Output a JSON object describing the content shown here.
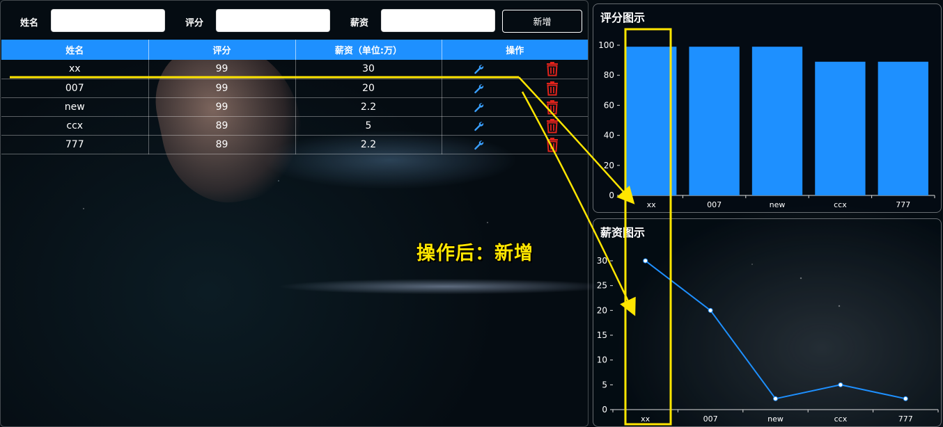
{
  "form": {
    "name_label": "姓名",
    "score_label": "评分",
    "salary_label": "薪资",
    "name_value": "",
    "score_value": "",
    "salary_value": "",
    "add_button": "新增"
  },
  "table": {
    "headers": [
      "姓名",
      "评分",
      "薪资（单位:万）",
      "操作"
    ],
    "rows": [
      {
        "name": "xx",
        "score": "99",
        "salary": "30"
      },
      {
        "name": "007",
        "score": "99",
        "salary": "20"
      },
      {
        "name": "new",
        "score": "99",
        "salary": "2.2"
      },
      {
        "name": "ccx",
        "score": "89",
        "salary": "5"
      },
      {
        "name": "777",
        "score": "89",
        "salary": "2.2"
      }
    ],
    "edit_icon": "wrench-icon",
    "delete_icon": "trash-icon"
  },
  "score_chart": {
    "title": "评分图示"
  },
  "salary_chart": {
    "title": "薪资图示"
  },
  "chart_data": [
    {
      "type": "bar",
      "title": "评分图示",
      "categories": [
        "xx",
        "007",
        "new",
        "ccx",
        "777"
      ],
      "values": [
        99,
        99,
        99,
        89,
        89
      ],
      "ylim": [
        0,
        100
      ],
      "yticks": [
        0,
        20,
        40,
        60,
        80,
        100
      ],
      "color": "#1e90ff",
      "grid": false
    },
    {
      "type": "line",
      "title": "薪资图示",
      "categories": [
        "xx",
        "007",
        "new",
        "ccx",
        "777"
      ],
      "values": [
        30,
        20,
        2.2,
        5,
        2.2
      ],
      "ylim": [
        0,
        30
      ],
      "yticks": [
        0,
        5,
        10,
        15,
        20,
        25,
        30
      ],
      "color": "#1e90ff",
      "grid": false
    }
  ],
  "annotation": {
    "text": "操作后：新增",
    "color": "#ffe600"
  }
}
